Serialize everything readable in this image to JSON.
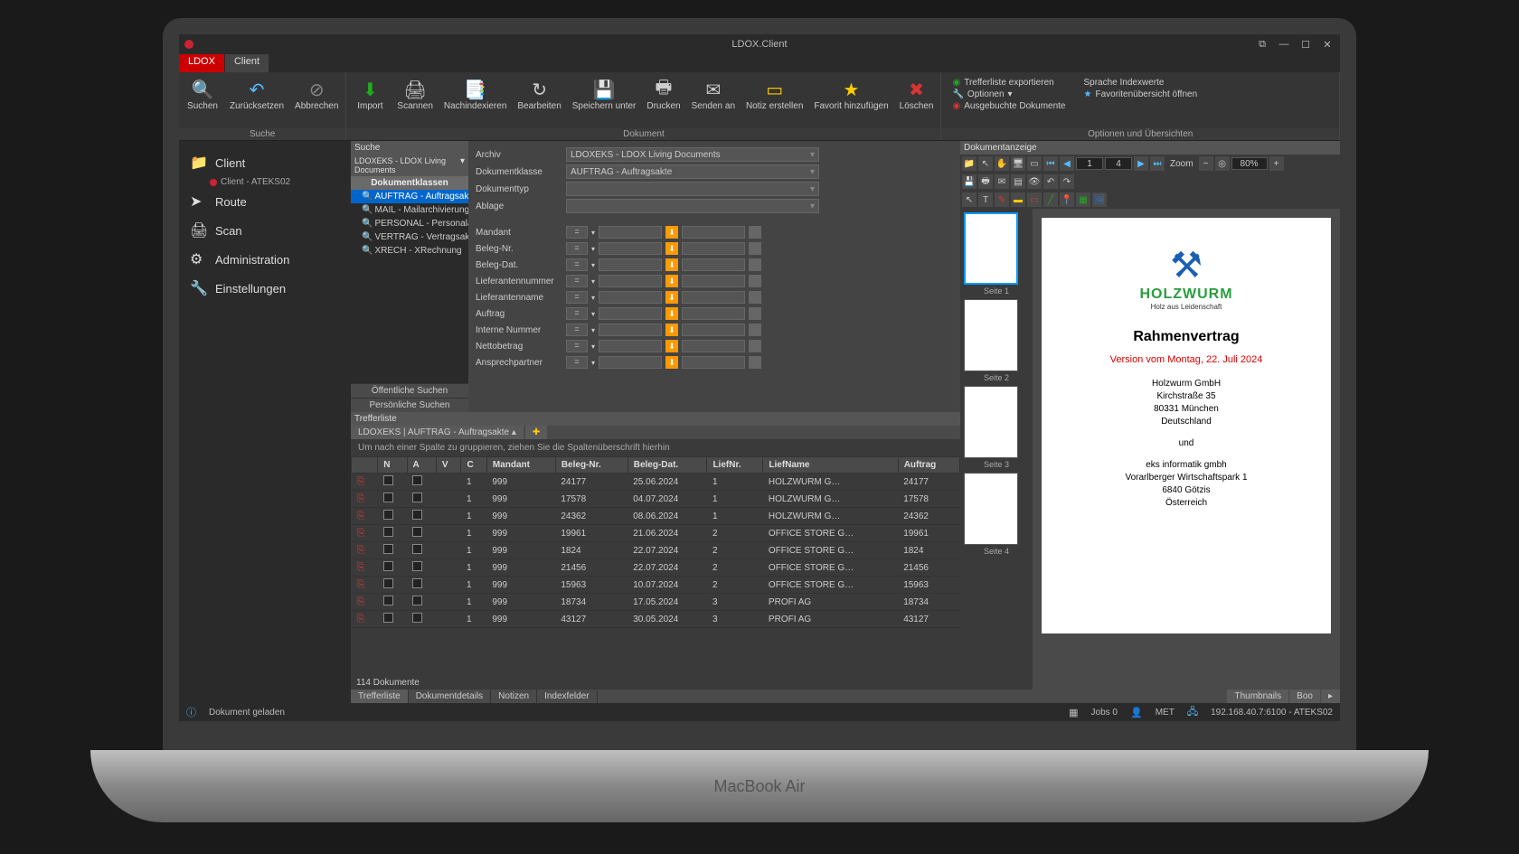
{
  "window": {
    "title": "LDOX.Client"
  },
  "tabs": {
    "ldox": "LDOX",
    "client": "Client"
  },
  "ribbon": {
    "suchen": "Suchen",
    "zurueck": "Zurücksetzen",
    "abbrechen": "Abbrechen",
    "import": "Import",
    "scannen": "Scannen",
    "nachindex": "Nachindexieren",
    "bearbeiten": "Bearbeiten",
    "speichern": "Speichern unter",
    "drucken": "Drucken",
    "senden": "Senden an",
    "notiz": "Notiz erstellen",
    "favorit": "Favorit hinzufügen",
    "loeschen": "Löschen",
    "group_suche": "Suche",
    "group_dokument": "Dokument",
    "group_optionen": "Optionen und Übersichten",
    "link_export": "Trefferliste exportieren",
    "link_optionen": "Optionen",
    "link_ausgebucht": "Ausgebuchte Dokumente",
    "link_sprache": "Sprache Indexwerte",
    "link_fav": "Favoritenübersicht öffnen"
  },
  "sidebar": {
    "client": "Client",
    "client_sub": "Client - ATEKS02",
    "route": "Route",
    "scan": "Scan",
    "admin": "Administration",
    "settings": "Einstellungen"
  },
  "tree": {
    "header": "Suche",
    "root": "LDOXEKS - LDOX Living Documents",
    "klassen": "Dokumentklassen",
    "items": {
      "0": "AUFTRAG - Auftragsakte",
      "1": "MAIL - Mailarchivierung",
      "2": "PERSONAL - Personalakte",
      "3": "VERTRAG - Vertragsakte",
      "4": "XRECH - XRechnung"
    },
    "pub": "Öffentliche Suchen",
    "pers": "Persönliche Suchen"
  },
  "form": {
    "archiv_lbl": "Archiv",
    "archiv_val": "LDOXEKS - LDOX Living Documents",
    "klasse_lbl": "Dokumentklasse",
    "klasse_val": "AUFTRAG - Auftragsakte",
    "typ_lbl": "Dokumenttyp",
    "ablage_lbl": "Ablage",
    "filters": {
      "0": "Mandant",
      "1": "Beleg-Nr.",
      "2": "Beleg-Dat.",
      "3": "Lieferantennummer",
      "4": "Lieferantenname",
      "5": "Auftrag",
      "6": "Interne Nummer",
      "7": "Nettobetrag",
      "8": "Ansprechpartner"
    }
  },
  "results": {
    "header": "Trefferliste",
    "tab": "LDOXEKS | AUFTRAG - Auftragsakte",
    "group_hint": "Um nach einer Spalte zu gruppieren, ziehen Sie die Spaltenüberschrift hierhin",
    "cols": {
      "n": "N",
      "a": "A",
      "v": "V",
      "c": "C",
      "mandant": "Mandant",
      "beleg": "Beleg-Nr.",
      "dat": "Beleg-Dat.",
      "liefnr": "LiefNr.",
      "liefname": "LiefName",
      "auftrag": "Auftrag"
    },
    "rows": [
      {
        "c": "1",
        "mandant": "999",
        "beleg": "24177",
        "dat": "25.06.2024",
        "liefnr": "1",
        "liefname": "HOLZWURM G…",
        "auftrag": "24177"
      },
      {
        "c": "1",
        "mandant": "999",
        "beleg": "17578",
        "dat": "04.07.2024",
        "liefnr": "1",
        "liefname": "HOLZWURM G…",
        "auftrag": "17578"
      },
      {
        "c": "1",
        "mandant": "999",
        "beleg": "24362",
        "dat": "08.06.2024",
        "liefnr": "1",
        "liefname": "HOLZWURM G…",
        "auftrag": "24362"
      },
      {
        "c": "1",
        "mandant": "999",
        "beleg": "19961",
        "dat": "21.06.2024",
        "liefnr": "2",
        "liefname": "OFFICE STORE G…",
        "auftrag": "19961"
      },
      {
        "c": "1",
        "mandant": "999",
        "beleg": "1824",
        "dat": "22.07.2024",
        "liefnr": "2",
        "liefname": "OFFICE STORE G…",
        "auftrag": "1824"
      },
      {
        "c": "1",
        "mandant": "999",
        "beleg": "21456",
        "dat": "22.07.2024",
        "liefnr": "2",
        "liefname": "OFFICE STORE G…",
        "auftrag": "21456"
      },
      {
        "c": "1",
        "mandant": "999",
        "beleg": "15963",
        "dat": "10.07.2024",
        "liefnr": "2",
        "liefname": "OFFICE STORE G…",
        "auftrag": "15963"
      },
      {
        "c": "1",
        "mandant": "999",
        "beleg": "18734",
        "dat": "17.05.2024",
        "liefnr": "3",
        "liefname": "PROFI AG",
        "auftrag": "18734"
      },
      {
        "c": "1",
        "mandant": "999",
        "beleg": "43127",
        "dat": "30.05.2024",
        "liefnr": "3",
        "liefname": "PROFI AG",
        "auftrag": "43127"
      }
    ],
    "count": "114 Dokumente",
    "btabs": {
      "treffer": "Trefferliste",
      "details": "Dokumentdetails",
      "notizen": "Notizen",
      "index": "Indexfelder"
    }
  },
  "preview": {
    "header": "Dokumentanzeige",
    "page_cur": "1",
    "page_total": "4",
    "zoom_lbl": "Zoom",
    "zoom_val": "80%",
    "thumbs": {
      "0": "Seite 1",
      "1": "Seite 2",
      "2": "Seite 3",
      "3": "Seite 4"
    },
    "ptabs": {
      "thumb": "Thumbnails",
      "boo": "Boo"
    },
    "doc": {
      "brand": "HOLZWURM",
      "tagline": "Holz aus Leidenschaft",
      "title": "Rahmenvertrag",
      "version": "Version vom Montag, 22. Juli 2024",
      "p1l1": "Holzwurm GmbH",
      "p1l2": "Kirchstraße 35",
      "p1l3": "80331 München",
      "p1l4": "Deutschland",
      "und": "und",
      "p2l1": "eks informatik gmbh",
      "p2l2": "Vorarlberger Wirtschaftspark 1",
      "p2l3": "6840 Götzis",
      "p2l4": "Österreich"
    }
  },
  "status": {
    "loaded": "Dokument geladen",
    "jobs": "Jobs 0",
    "user": "MET",
    "server": "192.168.40.7:6100 - ATEKS02"
  },
  "laptop": "MacBook Air"
}
